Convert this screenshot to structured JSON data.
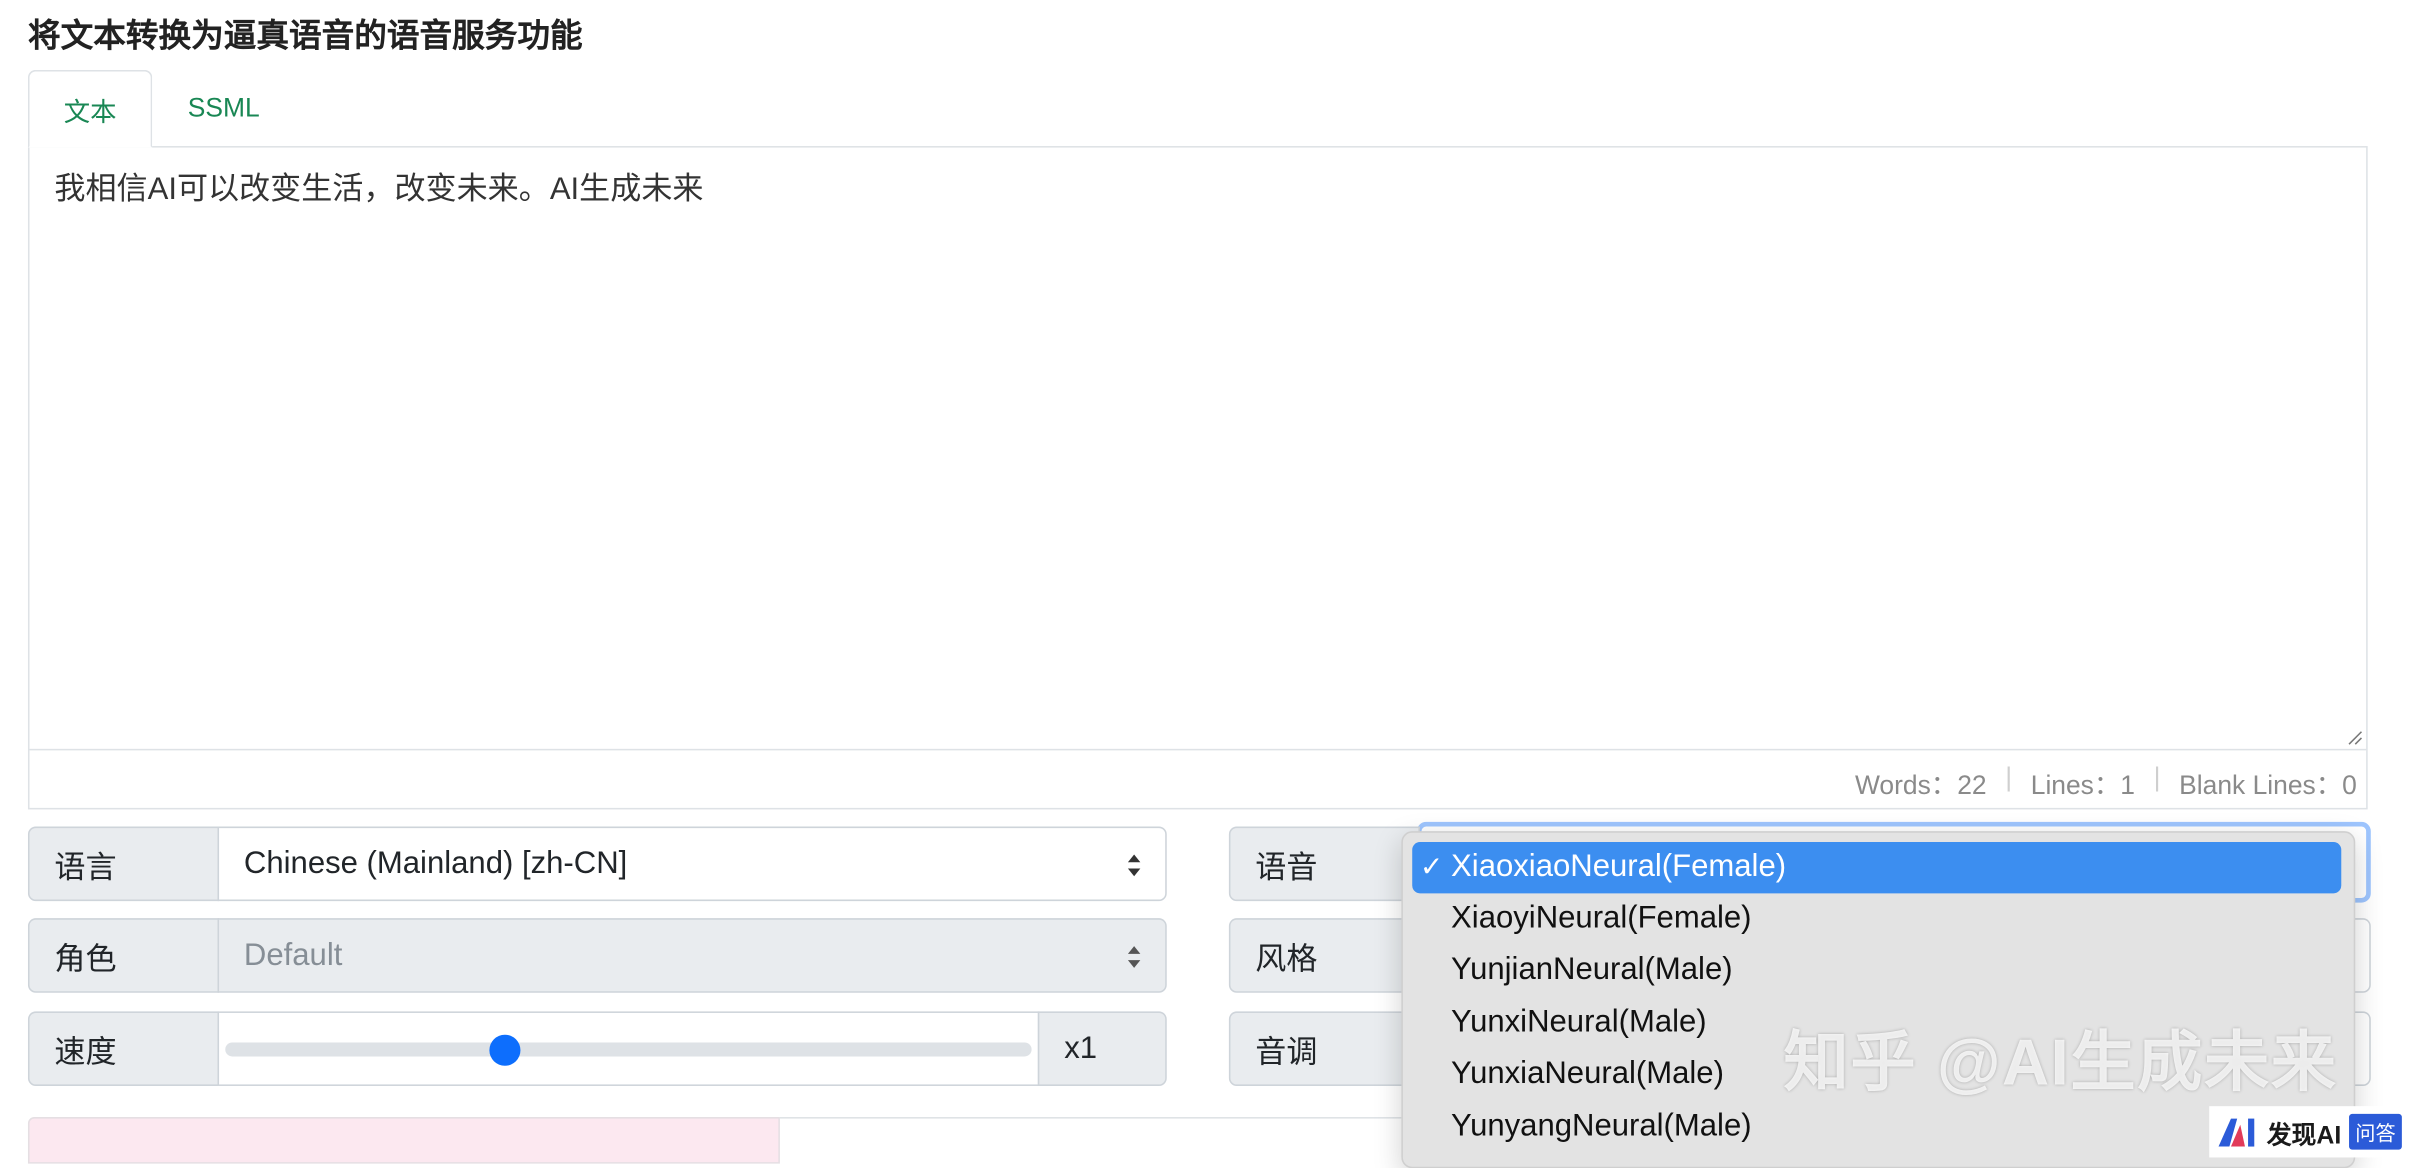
{
  "page": {
    "title": "将文本转换为逼真语音的语音服务功能"
  },
  "tabs": [
    {
      "label": "文本",
      "active": true
    },
    {
      "label": "SSML",
      "active": false
    }
  ],
  "editor": {
    "text": "我相信AI可以改变生活，改变未来。AI生成未来",
    "stats": {
      "words": "Words：22",
      "lines": "Lines：1",
      "blank_lines": "Blank Lines：0",
      "separator": "|"
    }
  },
  "controls": {
    "language": {
      "label": "语言",
      "value": "Chinese (Mainland) [zh-CN]"
    },
    "role": {
      "label": "角色",
      "value": "Default",
      "disabled": true
    },
    "speed": {
      "label": "速度",
      "multiplier": "x1",
      "slider_fraction": 0.34
    },
    "voice": {
      "label": "语音"
    },
    "style": {
      "label": "风格"
    },
    "pitch": {
      "label": "音调"
    }
  },
  "voice_dropdown": {
    "check_mark": "✓",
    "options": [
      {
        "label": "XiaoxiaoNeural(Female)",
        "selected": true
      },
      {
        "label": "XiaoyiNeural(Female)",
        "selected": false
      },
      {
        "label": "YunjianNeural(Male)",
        "selected": false
      },
      {
        "label": "YunxiNeural(Male)",
        "selected": false
      },
      {
        "label": "YunxiaNeural(Male)",
        "selected": false
      },
      {
        "label": "YunyangNeural(Male)",
        "selected": false
      }
    ]
  },
  "watermark": {
    "text": "知乎 @AI生成未来"
  },
  "brand": {
    "name": "发现AI",
    "badge": "问答"
  },
  "colors": {
    "accent_green": "#198754",
    "slider_blue": "#0d6efd",
    "dropdown_selected": "#3c8ef0",
    "focus_ring": "#9ec5fe",
    "label_bg": "#e9ecef"
  }
}
